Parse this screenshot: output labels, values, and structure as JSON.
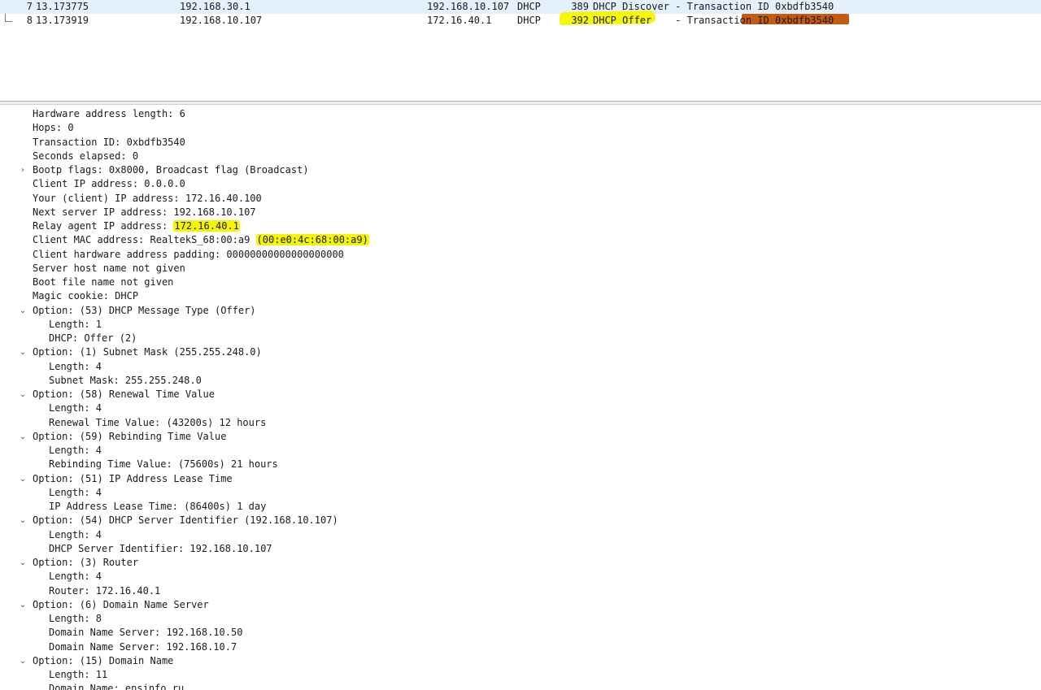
{
  "packets": [
    {
      "no": "7",
      "time": "13.173775",
      "source": "192.168.30.1",
      "destination": "192.168.10.107",
      "protocol": "DHCP",
      "length": "389",
      "info": "DHCP Discover - Transaction ID 0xbdfb3540"
    },
    {
      "no": "8",
      "time": "13.173919",
      "source": "192.168.10.107",
      "destination": "172.16.40.1",
      "protocol": "DHCP",
      "length": "392",
      "info": "DHCP Offer    - Transaction ID 0xbdfb3540"
    }
  ],
  "details": {
    "hw_len": "Hardware address length: 6",
    "hops": "Hops: 0",
    "xid": "Transaction ID: 0xbdfb3540",
    "secs": "Seconds elapsed: 0",
    "bootp_flags": "Bootp flags: 0x8000, Broadcast flag (Broadcast)",
    "ciaddr": "Client IP address: 0.0.0.0",
    "yiaddr": "Your (client) IP address: 172.16.40.100",
    "siaddr": "Next server IP address: 192.168.10.107",
    "giaddr_label": "Relay agent IP address: ",
    "giaddr_value": "172.16.40.1",
    "chaddr_label": "Client MAC address: RealtekS_68:00:a9 ",
    "chaddr_value": "(00:e0:4c:68:00:a9)",
    "padding": "Client hardware address padding: 00000000000000000000",
    "sname": "Server host name not given",
    "file": "Boot file name not given",
    "cookie": "Magic cookie: DHCP",
    "opt53": "Option: (53) DHCP Message Type (Offer)",
    "opt53_len": "Length: 1",
    "opt53_val": "DHCP: Offer (2)",
    "opt1": "Option: (1) Subnet Mask (255.255.248.0)",
    "opt1_len": "Length: 4",
    "opt1_val": "Subnet Mask: 255.255.248.0",
    "opt58": "Option: (58) Renewal Time Value",
    "opt58_len": "Length: 4",
    "opt58_val": "Renewal Time Value: (43200s) 12 hours",
    "opt59": "Option: (59) Rebinding Time Value",
    "opt59_len": "Length: 4",
    "opt59_val": "Rebinding Time Value: (75600s) 21 hours",
    "opt51": "Option: (51) IP Address Lease Time",
    "opt51_len": "Length: 4",
    "opt51_val": "IP Address Lease Time: (86400s) 1 day",
    "opt54": "Option: (54) DHCP Server Identifier (192.168.10.107)",
    "opt54_len": "Length: 4",
    "opt54_val": "DHCP Server Identifier: 192.168.10.107",
    "opt3": "Option: (3) Router",
    "opt3_len": "Length: 4",
    "opt3_val": "Router: 172.16.40.1",
    "opt6": "Option: (6) Domain Name Server",
    "opt6_len": "Length: 8",
    "opt6_val1": "Domain Name Server: 192.168.10.50",
    "opt6_val2": "Domain Name Server: 192.168.10.7",
    "opt15": "Option: (15) Domain Name",
    "opt15_len": "Length: 11",
    "opt15_val": "Domain Name: ensinfo.ru"
  },
  "icons": {
    "collapsed": "›",
    "expanded": "⌄"
  },
  "colors": {
    "highlight_yellow": "#f5f500",
    "highlight_orange": "#c55a11",
    "selected_row": "#c2cfd9",
    "row_bg": "#e4f0fb"
  }
}
